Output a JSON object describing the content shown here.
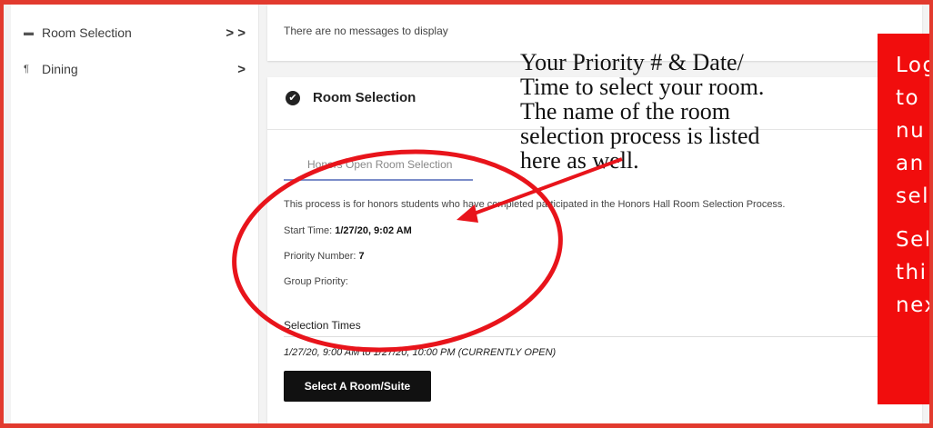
{
  "sidebar": {
    "items": [
      {
        "label": "Room Selection",
        "icon": "bed-icon",
        "chevron": "> >"
      },
      {
        "label": "Dining",
        "icon": "utensils-icon",
        "chevron": ">"
      }
    ]
  },
  "messages": {
    "text": "There are no messages to display"
  },
  "room_selection": {
    "title": "Room Selection",
    "tab_label": "Honors Open Room Selection",
    "description": "This process is for honors students who have completed participated in the Honors Hall Room Selection Process.",
    "start_time_label": "Start Time:",
    "start_time_value": "1/27/20, 9:02 AM",
    "priority_label": "Priority Number:",
    "priority_value": "7",
    "group_priority_label": "Group Priority:",
    "selection_times_heading": "Selection Times",
    "selection_range": "1/27/20, 9:00 AM to 1/27/20, 10:00 PM (CURRENTLY OPEN)",
    "select_button_label": "Select A Room/Suite"
  },
  "annotation": {
    "lines": [
      "Your Priority # & Date/",
      "Time to select your room.",
      "The name of the room",
      "selection process is listed",
      "here as well."
    ]
  },
  "red_callout": {
    "lines": [
      "Log",
      "to",
      "nu",
      "an",
      "sel",
      "Sel",
      "thi",
      "nex"
    ]
  },
  "colors": {
    "border_red": "#e23a2e",
    "callout_red": "#f10d0d",
    "annotation_red": "#e8141b",
    "tab_underline": "#7b8dc9"
  }
}
